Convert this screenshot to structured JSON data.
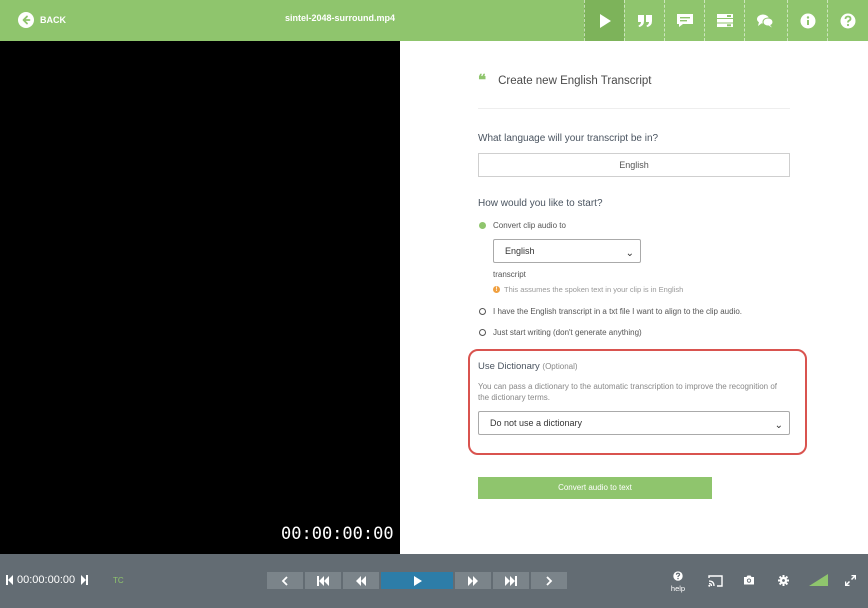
{
  "header": {
    "back_label": "BACK",
    "file_name": "sintel-2048-surround.mp4",
    "toolbar_icons": [
      "play-icon",
      "quote-icon",
      "comment-icon",
      "list-icon",
      "chat-icon",
      "info-icon",
      "help-icon"
    ]
  },
  "video": {
    "timecode": "00:00:00:00"
  },
  "panel": {
    "title": "Create new English Transcript",
    "language_question": "What language will your transcript be in?",
    "language_value": "English",
    "start_question": "How would you like to start?",
    "options": [
      {
        "label": "Convert clip audio to",
        "selected": true
      },
      {
        "label": "I have the English transcript in a txt file I want to align to the clip audio.",
        "selected": false
      },
      {
        "label": "Just start writing (don't generate anything)",
        "selected": false
      }
    ],
    "convert_language": "English",
    "transcript_word": "transcript",
    "note": "This assumes the spoken text in your clip is in English",
    "dictionary": {
      "label": "Use Dictionary",
      "optional": "(Optional)",
      "description": "You can pass a dictionary to the automatic transcription to improve the recognition of the dictionary terms.",
      "selected": "Do not use a dictionary"
    },
    "convert_button": "Convert audio to text"
  },
  "footer": {
    "timecode": "00:00:00:00",
    "tc_label": "TC",
    "help_label": "help"
  },
  "colors": {
    "accent": "#8fc56d",
    "highlight_border": "#d9534f",
    "play_button": "#2d7da8",
    "bottom_bar": "#636c73"
  }
}
